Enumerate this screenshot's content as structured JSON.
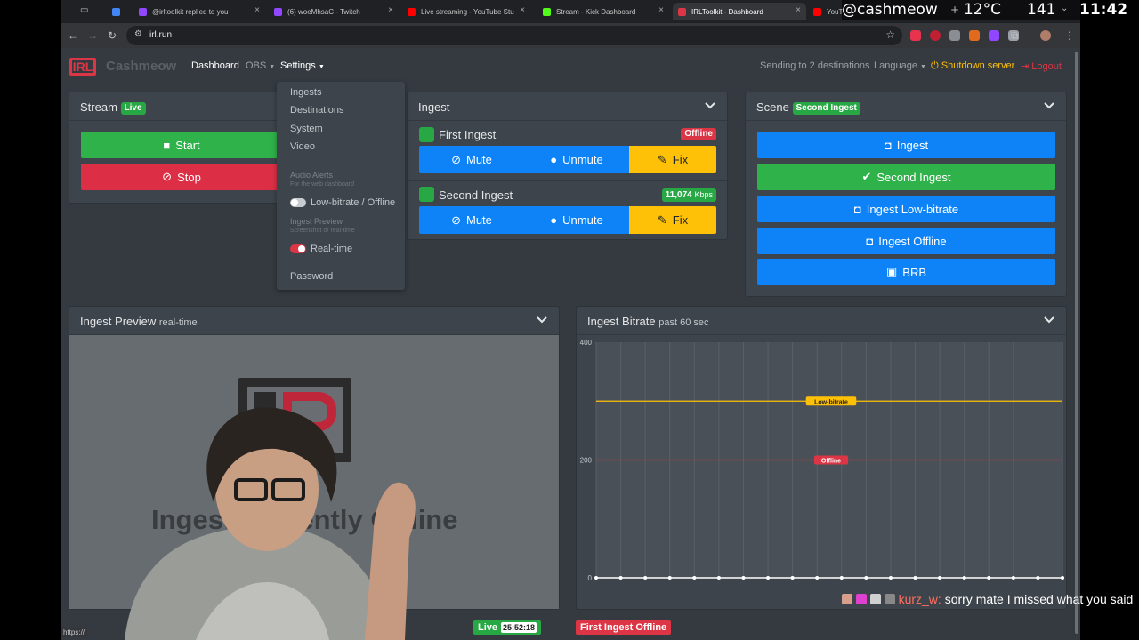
{
  "browser": {
    "tabs": [
      {
        "title": "",
        "icon": "calendar-icon",
        "color": "#4285f4"
      },
      {
        "title": "@irltoolkit replied to you",
        "icon": "twitch-icon",
        "color": "#9146ff"
      },
      {
        "title": "(6) woeMhsaC - Twitch",
        "icon": "twitch-icon",
        "color": "#9146ff"
      },
      {
        "title": "Live streaming - YouTube Stu",
        "icon": "youtube-icon",
        "color": "#ff0000"
      },
      {
        "title": "Stream - Kick Dashboard",
        "icon": "kick-icon",
        "color": "#53fc18"
      },
      {
        "title": "IRLToolkit - Dashboard",
        "icon": "irltoolkit-icon",
        "color": "#dc3545"
      },
      {
        "title": "YouT",
        "icon": "youtube-icon",
        "color": "#ff0000"
      }
    ],
    "url": "irl.run"
  },
  "app": {
    "brand": "Cashmeow",
    "logo_text": "IRL",
    "nav": {
      "dashboard": "Dashboard",
      "obs": "OBS",
      "settings": "Settings"
    },
    "right": {
      "destinations": "Sending to 2 destinations",
      "language": "Language",
      "shutdown": "Shutdown server",
      "logout": "Logout"
    },
    "settings_menu": {
      "ingests": "Ingests",
      "destinations": "Destinations",
      "system": "System",
      "video": "Video",
      "audio_alerts_head": "Audio Alerts",
      "audio_alerts_sub": "For the web dashboard",
      "audio_alerts_toggle": "Low-bitrate / Offline",
      "ingest_preview_head": "Ingest Preview",
      "ingest_preview_sub": "Screenshot or real-time",
      "ingest_preview_toggle": "Real-time",
      "password": "Password"
    },
    "stream": {
      "title": "Stream",
      "badge": "Live",
      "start": "Start",
      "stop": "Stop"
    },
    "ingest": {
      "title": "Ingest",
      "first": {
        "name": "First Ingest",
        "status": "Offline",
        "mute": "Mute",
        "unmute": "Unmute",
        "fix": "Fix"
      },
      "second": {
        "name": "Second Ingest",
        "status_value": "11,074",
        "status_unit": "Kbps",
        "mute": "Mute",
        "unmute": "Unmute",
        "fix": "Fix"
      }
    },
    "scene": {
      "title": "Scene",
      "badge": "Second Ingest",
      "buttons": [
        "Ingest",
        "Second Ingest",
        "Ingest Low-bitrate",
        "Ingest Offline",
        "BRB"
      ],
      "active": "Second Ingest"
    },
    "preview": {
      "title": "Ingest Preview",
      "subtitle": "real-time",
      "message": "Ingest Currently Offline"
    },
    "bitrate": {
      "title": "Ingest Bitrate",
      "subtitle": "past 60 sec"
    },
    "status_bar": {
      "url_hint": "https://",
      "live": "Live",
      "timer": "25:52:18",
      "ingest_status": "First Ingest Offline"
    }
  },
  "chart_data": {
    "type": "line",
    "title": "",
    "xlabel": "",
    "ylabel": "",
    "ylim": [
      0,
      400
    ],
    "yticks": [
      "400",
      "200",
      "0"
    ],
    "x": [
      0,
      1,
      2,
      3,
      4,
      5,
      6,
      7,
      8,
      9,
      10,
      11,
      12,
      13,
      14,
      15,
      16,
      17,
      18,
      19
    ],
    "series": [
      {
        "values": [
          0,
          0,
          0,
          0,
          0,
          0,
          0,
          0,
          0,
          0,
          0,
          0,
          0,
          0,
          0,
          0,
          0,
          0,
          0,
          0
        ],
        "color": "#ffffff"
      }
    ],
    "thresholds": [
      {
        "label": "Low-bitrate",
        "value": 300,
        "color": "#ffc107"
      },
      {
        "label": "Offline",
        "value": 200,
        "color": "#dc3545"
      }
    ],
    "grid": true
  },
  "overlay": {
    "username": "@cashmeow",
    "temperature": "12°C",
    "count": "141",
    "clock": "11:42",
    "chat_user": "kurz_w:",
    "chat_message": "sorry mate I missed what you said",
    "accent": "#ff6f61"
  }
}
